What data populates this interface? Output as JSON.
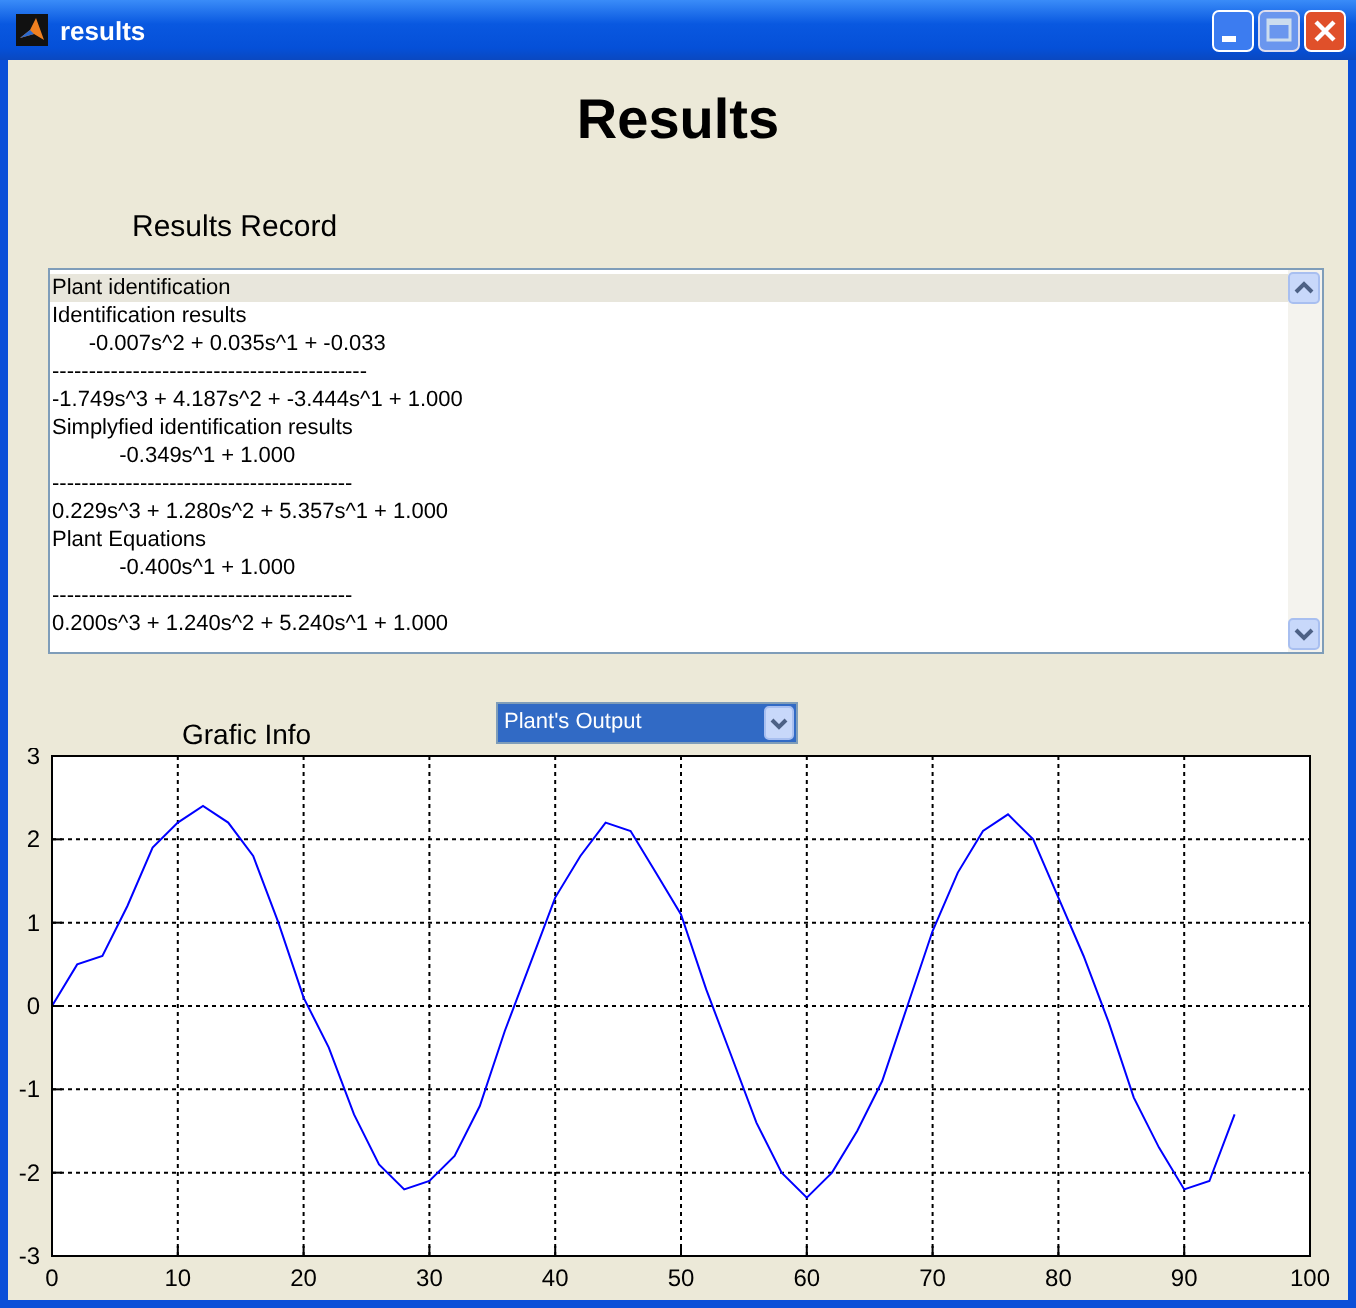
{
  "window": {
    "title": "results"
  },
  "heading": "Results",
  "record_label": "Results Record",
  "record_list": {
    "items": [
      {
        "text": "Plant identification",
        "selected": true
      },
      {
        "text": "Identification results",
        "selected": false
      },
      {
        "text": "      -0.007s^2 + 0.035s^1 + -0.033",
        "selected": false
      },
      {
        "text": "-------------------------------------------",
        "selected": false
      },
      {
        "text": "-1.749s^3 + 4.187s^2 + -3.444s^1 + 1.000",
        "selected": false
      },
      {
        "text": "Simplyfied identification results",
        "selected": false
      },
      {
        "text": "           -0.349s^1 + 1.000",
        "selected": false
      },
      {
        "text": "-----------------------------------------",
        "selected": false
      },
      {
        "text": "0.229s^3 + 1.280s^2 + 5.357s^1 + 1.000",
        "selected": false
      },
      {
        "text": "Plant Equations",
        "selected": false
      },
      {
        "text": "           -0.400s^1 + 1.000",
        "selected": false
      },
      {
        "text": "-----------------------------------------",
        "selected": false
      },
      {
        "text": "0.200s^3 + 1.240s^2 + 5.240s^1 + 1.000",
        "selected": false
      }
    ]
  },
  "graphic_label": "Grafic Info",
  "graphic_select": {
    "value": "Plant's Output"
  },
  "chart_data": {
    "type": "line",
    "xlim": [
      0,
      100
    ],
    "ylim": [
      -3,
      3
    ],
    "xticks": [
      0,
      10,
      20,
      30,
      40,
      50,
      60,
      70,
      80,
      90,
      100
    ],
    "yticks": [
      -3,
      -2,
      -1,
      0,
      1,
      2,
      3
    ],
    "x": [
      0,
      2,
      4,
      6,
      8,
      10,
      12,
      14,
      16,
      18,
      20,
      22,
      24,
      26,
      28,
      30,
      32,
      34,
      36,
      38,
      40,
      42,
      44,
      46,
      48,
      50,
      52,
      54,
      56,
      58,
      60,
      62,
      64,
      66,
      68,
      70,
      72,
      74,
      76,
      78,
      80,
      82,
      84,
      86,
      88,
      90,
      92,
      94
    ],
    "grid": true,
    "series": [
      {
        "color": "#0000ff",
        "values": [
          0,
          0.5,
          0.6,
          1.2,
          1.9,
          2.2,
          2.4,
          2.2,
          1.8,
          1.0,
          0.1,
          -0.5,
          -1.3,
          -1.9,
          -2.2,
          -2.1,
          -1.8,
          -1.2,
          -0.3,
          0.5,
          1.3,
          1.8,
          2.2,
          2.1,
          1.6,
          1.1,
          0.2,
          -0.6,
          -1.4,
          -2.0,
          -2.3,
          -2.0,
          -1.5,
          -0.9,
          0.0,
          0.9,
          1.6,
          2.1,
          2.3,
          2.0,
          1.3,
          0.6,
          -0.2,
          -1.1,
          -1.7,
          -2.2,
          -2.1,
          -1.3
        ]
      }
    ]
  }
}
